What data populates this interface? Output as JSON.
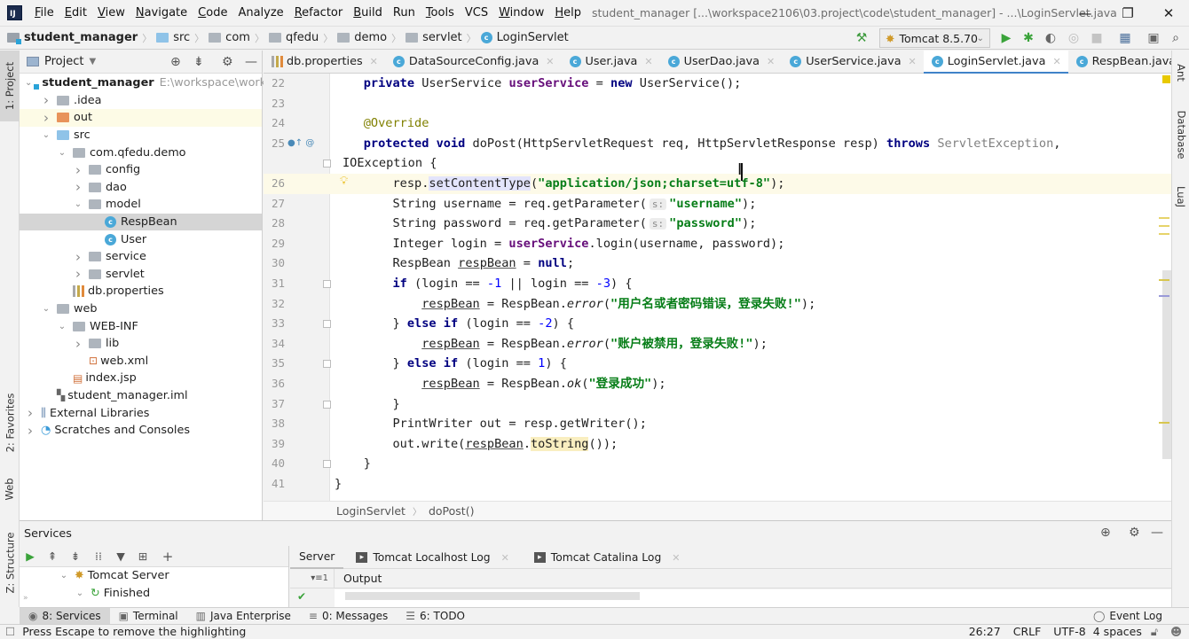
{
  "titlebar": {
    "app_icon": "IJ",
    "menu": [
      {
        "label": "File",
        "mnemonic": "F"
      },
      {
        "label": "Edit",
        "mnemonic": "E"
      },
      {
        "label": "View",
        "mnemonic": "V"
      },
      {
        "label": "Navigate",
        "mnemonic": "N"
      },
      {
        "label": "Code",
        "mnemonic": "C"
      },
      {
        "label": "Analyze",
        "mnemonic": ""
      },
      {
        "label": "Refactor",
        "mnemonic": "R"
      },
      {
        "label": "Build",
        "mnemonic": "B"
      },
      {
        "label": "Run",
        "mnemonic": ""
      },
      {
        "label": "Tools",
        "mnemonic": "T"
      },
      {
        "label": "VCS",
        "mnemonic": ""
      },
      {
        "label": "Window",
        "mnemonic": "W"
      },
      {
        "label": "Help",
        "mnemonic": "H"
      }
    ],
    "window_title": "student_manager [...\\workspace2106\\03.project\\code\\student_manager] - ...\\LoginServlet.java",
    "minimize": "—",
    "restore": "❐",
    "close": "✕"
  },
  "navbar": {
    "breadcrumbs": [
      "student_manager",
      "src",
      "com",
      "qfedu",
      "demo",
      "servlet",
      "LoginServlet"
    ],
    "run_config": "Tomcat 8.5.70"
  },
  "left_stripe": {
    "project": "1: Project",
    "favorites": "2: Favorites",
    "web": "Web",
    "structure": "Z: Structure"
  },
  "right_stripe": {
    "ant": "Ant",
    "database": "Database",
    "luaj": "LuaJ"
  },
  "project_panel": {
    "title": "Project",
    "tree": [
      {
        "label": "student_manager",
        "extra": "E:\\workspace\\worksp",
        "indent": 0,
        "arrow": "open",
        "icon": "project",
        "bold": true
      },
      {
        "label": ".idea",
        "indent": 1,
        "arrow": "closed",
        "icon": "folder"
      },
      {
        "label": "out",
        "indent": 1,
        "arrow": "closed",
        "icon": "folder-orange",
        "highlight": "yellow"
      },
      {
        "label": "src",
        "indent": 1,
        "arrow": "open",
        "icon": "folder-blue"
      },
      {
        "label": "com.qfedu.demo",
        "indent": 2,
        "arrow": "open",
        "icon": "package"
      },
      {
        "label": "config",
        "indent": 3,
        "arrow": "closed",
        "icon": "package"
      },
      {
        "label": "dao",
        "indent": 3,
        "arrow": "closed",
        "icon": "package"
      },
      {
        "label": "model",
        "indent": 3,
        "arrow": "open",
        "icon": "package"
      },
      {
        "label": "RespBean",
        "indent": 4,
        "arrow": "none",
        "icon": "class",
        "selected": true
      },
      {
        "label": "User",
        "indent": 4,
        "arrow": "none",
        "icon": "class"
      },
      {
        "label": "service",
        "indent": 3,
        "arrow": "closed",
        "icon": "package"
      },
      {
        "label": "servlet",
        "indent": 3,
        "arrow": "closed",
        "icon": "package"
      },
      {
        "label": "db.properties",
        "indent": 2,
        "arrow": "none",
        "icon": "properties"
      },
      {
        "label": "web",
        "indent": 1,
        "arrow": "open",
        "icon": "folder-web"
      },
      {
        "label": "WEB-INF",
        "indent": 2,
        "arrow": "open",
        "icon": "folder"
      },
      {
        "label": "lib",
        "indent": 3,
        "arrow": "closed",
        "icon": "folder"
      },
      {
        "label": "web.xml",
        "indent": 3,
        "arrow": "none",
        "icon": "xml"
      },
      {
        "label": "index.jsp",
        "indent": 2,
        "arrow": "none",
        "icon": "jsp"
      },
      {
        "label": "student_manager.iml",
        "indent": 1,
        "arrow": "none",
        "icon": "iml"
      },
      {
        "label": "External Libraries",
        "indent": 0,
        "arrow": "closed",
        "icon": "libraries"
      },
      {
        "label": "Scratches and Consoles",
        "indent": 0,
        "arrow": "closed",
        "icon": "scratches"
      }
    ]
  },
  "editor_tabs": [
    {
      "label": "db.properties",
      "icon": "properties"
    },
    {
      "label": "DataSourceConfig.java",
      "icon": "class"
    },
    {
      "label": "User.java",
      "icon": "class"
    },
    {
      "label": "UserDao.java",
      "icon": "class"
    },
    {
      "label": "UserService.java",
      "icon": "class"
    },
    {
      "label": "LoginServlet.java",
      "icon": "class",
      "active": true
    },
    {
      "label": "RespBean.java",
      "icon": "class"
    }
  ],
  "code": {
    "lines": [
      {
        "n": "22",
        "tokens": [
          [
            "    ",
            ""
          ],
          [
            "private",
            "kw"
          ],
          [
            " UserService ",
            ""
          ],
          [
            "userService",
            "fld"
          ],
          [
            " = ",
            ""
          ],
          [
            "new",
            "kw"
          ],
          [
            " UserService();",
            ""
          ]
        ]
      },
      {
        "n": "23",
        "tokens": []
      },
      {
        "n": "24",
        "tokens": [
          [
            "    ",
            ""
          ],
          [
            "@Override",
            "ann"
          ]
        ]
      },
      {
        "n": "25",
        "gutter_icons": "override-at",
        "tokens": [
          [
            "    ",
            ""
          ],
          [
            "protected",
            "kw"
          ],
          [
            " ",
            ""
          ],
          [
            "void",
            "kw"
          ],
          [
            " doPost(HttpServletRequest req, HttpServletResponse resp) ",
            ""
          ],
          [
            "throws",
            "kw"
          ],
          [
            " ",
            ""
          ],
          [
            "ServletException",
            "gray"
          ],
          [
            ",",
            ""
          ]
        ]
      },
      {
        "n": "",
        "wrap": true,
        "tokens": [
          [
            "IOException {",
            ""
          ]
        ]
      },
      {
        "n": "26",
        "current": true,
        "bulb": true,
        "tokens": [
          [
            "        resp.",
            ""
          ],
          [
            "setContentType",
            "hl"
          ],
          [
            "(",
            ""
          ],
          [
            "\"application/json;charset=utf-8\"",
            "str"
          ],
          [
            ");",
            ""
          ]
        ]
      },
      {
        "n": "27",
        "tokens": [
          [
            "        String username = req.getParameter(",
            ""
          ],
          [
            "s:",
            "hint"
          ],
          [
            "\"username\"",
            "str"
          ],
          [
            ");",
            ""
          ]
        ]
      },
      {
        "n": "28",
        "tokens": [
          [
            "        String password = req.getParameter(",
            ""
          ],
          [
            "s:",
            "hint"
          ],
          [
            "\"password\"",
            "str"
          ],
          [
            ");",
            ""
          ]
        ]
      },
      {
        "n": "29",
        "tokens": [
          [
            "        Integer login = ",
            ""
          ],
          [
            "userService",
            "fld"
          ],
          [
            ".login(username, password);",
            ""
          ]
        ]
      },
      {
        "n": "30",
        "tokens": [
          [
            "        RespBean ",
            ""
          ],
          [
            "respBean",
            "ul"
          ],
          [
            " = ",
            ""
          ],
          [
            "null",
            "kw"
          ],
          [
            ";",
            ""
          ]
        ]
      },
      {
        "n": "31",
        "fold": true,
        "tokens": [
          [
            "        ",
            ""
          ],
          [
            "if",
            "kw"
          ],
          [
            " (login == ",
            ""
          ],
          [
            "-1",
            "num"
          ],
          [
            " || login == ",
            ""
          ],
          [
            "-3",
            "num"
          ],
          [
            ") {",
            ""
          ]
        ]
      },
      {
        "n": "32",
        "tokens": [
          [
            "            ",
            ""
          ],
          [
            "respBean",
            "ul"
          ],
          [
            " = RespBean.",
            ""
          ],
          [
            "error",
            "it"
          ],
          [
            "(",
            ""
          ],
          [
            "\"用户名或者密码错误，登录失败!\"",
            "str"
          ],
          [
            ");",
            ""
          ]
        ]
      },
      {
        "n": "33",
        "fold": true,
        "tokens": [
          [
            "        } ",
            ""
          ],
          [
            "else if",
            "kw"
          ],
          [
            " (login == ",
            ""
          ],
          [
            "-2",
            "num"
          ],
          [
            ") {",
            ""
          ]
        ]
      },
      {
        "n": "34",
        "tokens": [
          [
            "            ",
            ""
          ],
          [
            "respBean",
            "ul"
          ],
          [
            " = RespBean.",
            ""
          ],
          [
            "error",
            "it"
          ],
          [
            "(",
            ""
          ],
          [
            "\"账户被禁用，登录失败!\"",
            "str"
          ],
          [
            ");",
            ""
          ]
        ]
      },
      {
        "n": "35",
        "fold": true,
        "tokens": [
          [
            "        } ",
            ""
          ],
          [
            "else if",
            "kw"
          ],
          [
            " (login == ",
            ""
          ],
          [
            "1",
            "num"
          ],
          [
            ") {",
            ""
          ]
        ]
      },
      {
        "n": "36",
        "tokens": [
          [
            "            ",
            ""
          ],
          [
            "respBean",
            "ul"
          ],
          [
            " = RespBean.",
            ""
          ],
          [
            "ok",
            "it"
          ],
          [
            "(",
            ""
          ],
          [
            "\"登录成功\"",
            "str"
          ],
          [
            ");",
            ""
          ]
        ]
      },
      {
        "n": "37",
        "fold": true,
        "tokens": [
          [
            "        }",
            ""
          ]
        ]
      },
      {
        "n": "38",
        "tokens": [
          [
            "        PrintWriter out = resp.getWriter();",
            ""
          ]
        ]
      },
      {
        "n": "39",
        "tokens": [
          [
            "        out.write(",
            ""
          ],
          [
            "respBean",
            "ul"
          ],
          [
            ".",
            ""
          ],
          [
            "toString",
            "hly"
          ],
          [
            "());",
            ""
          ]
        ]
      },
      {
        "n": "40",
        "fold": true,
        "tokens": [
          [
            "    }",
            ""
          ]
        ]
      },
      {
        "n": "41",
        "tokens": [
          [
            "}",
            ""
          ]
        ]
      }
    ]
  },
  "editor_breadcrumb": [
    "LoginServlet",
    "doPost()"
  ],
  "services": {
    "title": "Services",
    "tree": [
      {
        "label": "Tomcat Server",
        "indent": 0
      },
      {
        "label": "Finished",
        "indent": 1
      }
    ],
    "tabs": [
      "Server",
      "Tomcat Localhost Log",
      "Tomcat Catalina Log"
    ],
    "output_label": "Output",
    "output_count": "1"
  },
  "bottom_tabs": [
    {
      "label": "8: Services",
      "active": true,
      "icon": "services"
    },
    {
      "label": "Terminal",
      "icon": "terminal"
    },
    {
      "label": "Java Enterprise",
      "icon": "java-enterprise"
    },
    {
      "label": "0: Messages",
      "icon": "messages"
    },
    {
      "label": "6: TODO",
      "icon": "todo"
    }
  ],
  "event_log": "Event Log",
  "statusbar": {
    "message": "Press Escape to remove the highlighting",
    "position": "26:27",
    "line_sep": "CRLF",
    "encoding": "UTF-8",
    "indent": "4 spaces"
  }
}
